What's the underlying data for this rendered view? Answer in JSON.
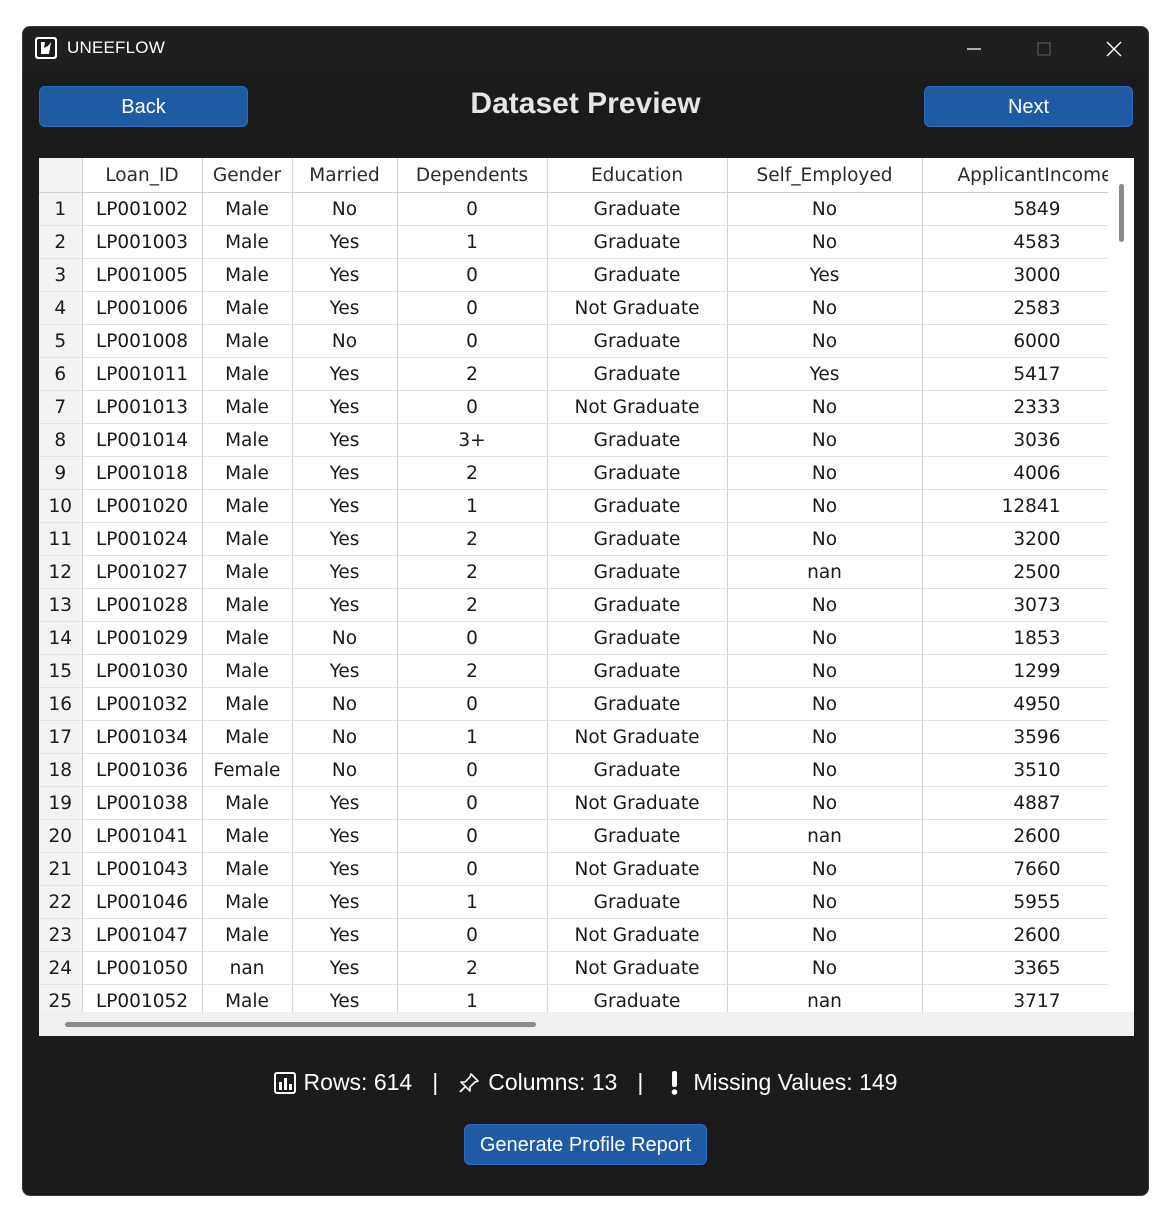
{
  "window": {
    "title": "UNEEFLOW",
    "controls": [
      "minimize",
      "maximize",
      "close"
    ]
  },
  "header": {
    "back_label": "Back",
    "title": "Dataset Preview",
    "next_label": "Next"
  },
  "table": {
    "columns": [
      "Loan_ID",
      "Gender",
      "Married",
      "Dependents",
      "Education",
      "Self_Employed",
      "ApplicantIncome"
    ],
    "rows": [
      [
        "1",
        "LP001002",
        "Male",
        "No",
        "0",
        "Graduate",
        "No",
        "5849"
      ],
      [
        "2",
        "LP001003",
        "Male",
        "Yes",
        "1",
        "Graduate",
        "No",
        "4583"
      ],
      [
        "3",
        "LP001005",
        "Male",
        "Yes",
        "0",
        "Graduate",
        "Yes",
        "3000"
      ],
      [
        "4",
        "LP001006",
        "Male",
        "Yes",
        "0",
        "Not Graduate",
        "No",
        "2583"
      ],
      [
        "5",
        "LP001008",
        "Male",
        "No",
        "0",
        "Graduate",
        "No",
        "6000"
      ],
      [
        "6",
        "LP001011",
        "Male",
        "Yes",
        "2",
        "Graduate",
        "Yes",
        "5417"
      ],
      [
        "7",
        "LP001013",
        "Male",
        "Yes",
        "0",
        "Not Graduate",
        "No",
        "2333"
      ],
      [
        "8",
        "LP001014",
        "Male",
        "Yes",
        "3+",
        "Graduate",
        "No",
        "3036"
      ],
      [
        "9",
        "LP001018",
        "Male",
        "Yes",
        "2",
        "Graduate",
        "No",
        "4006"
      ],
      [
        "10",
        "LP001020",
        "Male",
        "Yes",
        "1",
        "Graduate",
        "No",
        "12841"
      ],
      [
        "11",
        "LP001024",
        "Male",
        "Yes",
        "2",
        "Graduate",
        "No",
        "3200"
      ],
      [
        "12",
        "LP001027",
        "Male",
        "Yes",
        "2",
        "Graduate",
        "nan",
        "2500"
      ],
      [
        "13",
        "LP001028",
        "Male",
        "Yes",
        "2",
        "Graduate",
        "No",
        "3073"
      ],
      [
        "14",
        "LP001029",
        "Male",
        "No",
        "0",
        "Graduate",
        "No",
        "1853"
      ],
      [
        "15",
        "LP001030",
        "Male",
        "Yes",
        "2",
        "Graduate",
        "No",
        "1299"
      ],
      [
        "16",
        "LP001032",
        "Male",
        "No",
        "0",
        "Graduate",
        "No",
        "4950"
      ],
      [
        "17",
        "LP001034",
        "Male",
        "No",
        "1",
        "Not Graduate",
        "No",
        "3596"
      ],
      [
        "18",
        "LP001036",
        "Female",
        "No",
        "0",
        "Graduate",
        "No",
        "3510"
      ],
      [
        "19",
        "LP001038",
        "Male",
        "Yes",
        "0",
        "Not Graduate",
        "No",
        "4887"
      ],
      [
        "20",
        "LP001041",
        "Male",
        "Yes",
        "0",
        "Graduate",
        "nan",
        "2600"
      ],
      [
        "21",
        "LP001043",
        "Male",
        "Yes",
        "0",
        "Not Graduate",
        "No",
        "7660"
      ],
      [
        "22",
        "LP001046",
        "Male",
        "Yes",
        "1",
        "Graduate",
        "No",
        "5955"
      ],
      [
        "23",
        "LP001047",
        "Male",
        "Yes",
        "0",
        "Not Graduate",
        "No",
        "2600"
      ],
      [
        "24",
        "LP001050",
        "nan",
        "Yes",
        "2",
        "Not Graduate",
        "No",
        "3365"
      ],
      [
        "25",
        "LP001052",
        "Male",
        "Yes",
        "1",
        "Graduate",
        "nan",
        "3717"
      ]
    ]
  },
  "stats": {
    "rows_label": "Rows: 614",
    "columns_label": "Columns: 13",
    "missing_label": "Missing Values: 149",
    "separator": "|",
    "icons": [
      "bar-chart-icon",
      "pin-icon",
      "exclamation-icon"
    ]
  },
  "report_button_label": "Generate Profile Report",
  "colors": {
    "window_bg": "#1b1b1b",
    "button_bg": "#1f5aa5",
    "table_bg": "#ffffff",
    "index_bg": "#f3f3f3"
  }
}
